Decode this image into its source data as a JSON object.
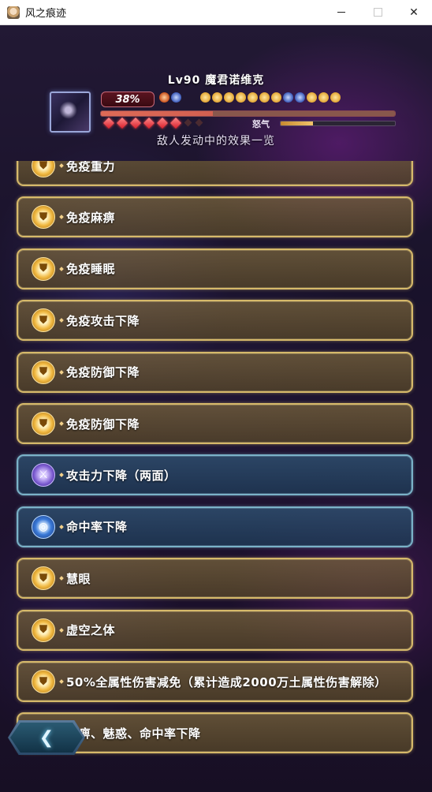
{
  "window": {
    "title": "风之痕迹",
    "minimize": "",
    "maximize": "",
    "close": "✕"
  },
  "boss": {
    "name": "Lv90 魔君诺维克",
    "hp_text": "38%",
    "hp_fraction": 0.38,
    "rage_label": "怒气",
    "rage_fraction": 0.28,
    "diamonds_on": 6,
    "diamonds_total": 8,
    "status_icons_left": [
      "fire-buff-icon",
      "blue-buff-icon"
    ],
    "status_icons_right": [
      "gold-buff-icon",
      "gold-buff-icon",
      "gold-buff-icon",
      "gold-buff-icon",
      "gold-buff-icon",
      "gold-buff-icon",
      "gold-buff-icon",
      "blue-buff-icon",
      "blue-buff-icon",
      "gold-buff-icon",
      "gold-buff-icon",
      "gold-buff-icon"
    ]
  },
  "panel": {
    "subtitle": "敌人发动中的效果一览"
  },
  "effects": [
    {
      "label": "免疫重力",
      "style": "gold",
      "icon": "shield-icon"
    },
    {
      "label": "免疫麻痹",
      "style": "gold",
      "icon": "shield-icon"
    },
    {
      "label": "免疫睡眠",
      "style": "gold",
      "icon": "shield-icon"
    },
    {
      "label": "免疫攻击下降",
      "style": "gold",
      "icon": "shield-icon"
    },
    {
      "label": "免疫防御下降",
      "style": "gold",
      "icon": "shield-icon"
    },
    {
      "label": "免疫防御下降",
      "style": "gold",
      "icon": "shield-icon"
    },
    {
      "label": "攻击力下降（两面）",
      "style": "blue",
      "icon": "sword-icon"
    },
    {
      "label": "命中率下降",
      "style": "blue",
      "icon": "target-icon"
    },
    {
      "label": "慧眼",
      "style": "gold",
      "icon": "shield-icon"
    },
    {
      "label": "虚空之体",
      "style": "gold",
      "icon": "shield-icon"
    },
    {
      "label": "50%全属性伤害减免（累计造成2000万土属性伤害解除）",
      "style": "gold",
      "icon": "shield-icon"
    },
    {
      "label": "麻痹、魅惑、命中率下降",
      "style": "gold",
      "icon": "shield-icon"
    }
  ],
  "back_button": {
    "icon": "back-arrow-icon"
  }
}
